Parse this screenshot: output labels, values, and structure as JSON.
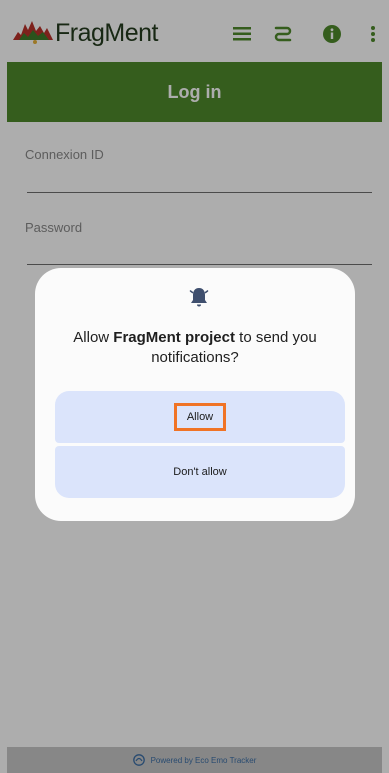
{
  "app": {
    "title": "FragMent",
    "icons": [
      "menu-icon",
      "route-icon",
      "info-icon",
      "more-vert-icon"
    ]
  },
  "page": {
    "title": "Log in"
  },
  "form": {
    "connexion_label": "Connexion ID",
    "password_label": "Password"
  },
  "dialog": {
    "text_prefix": "Allow ",
    "app_name": "FragMent project",
    "text_suffix": " to send you notifications?",
    "allow_label": "Allow",
    "deny_label": "Don't allow"
  },
  "footer": {
    "text": "Powered by Eco Emo Tracker"
  },
  "colors": {
    "header_green": "#4f8a2b",
    "button_blue": "#dbe4fb",
    "highlight_orange": "#f07325"
  }
}
